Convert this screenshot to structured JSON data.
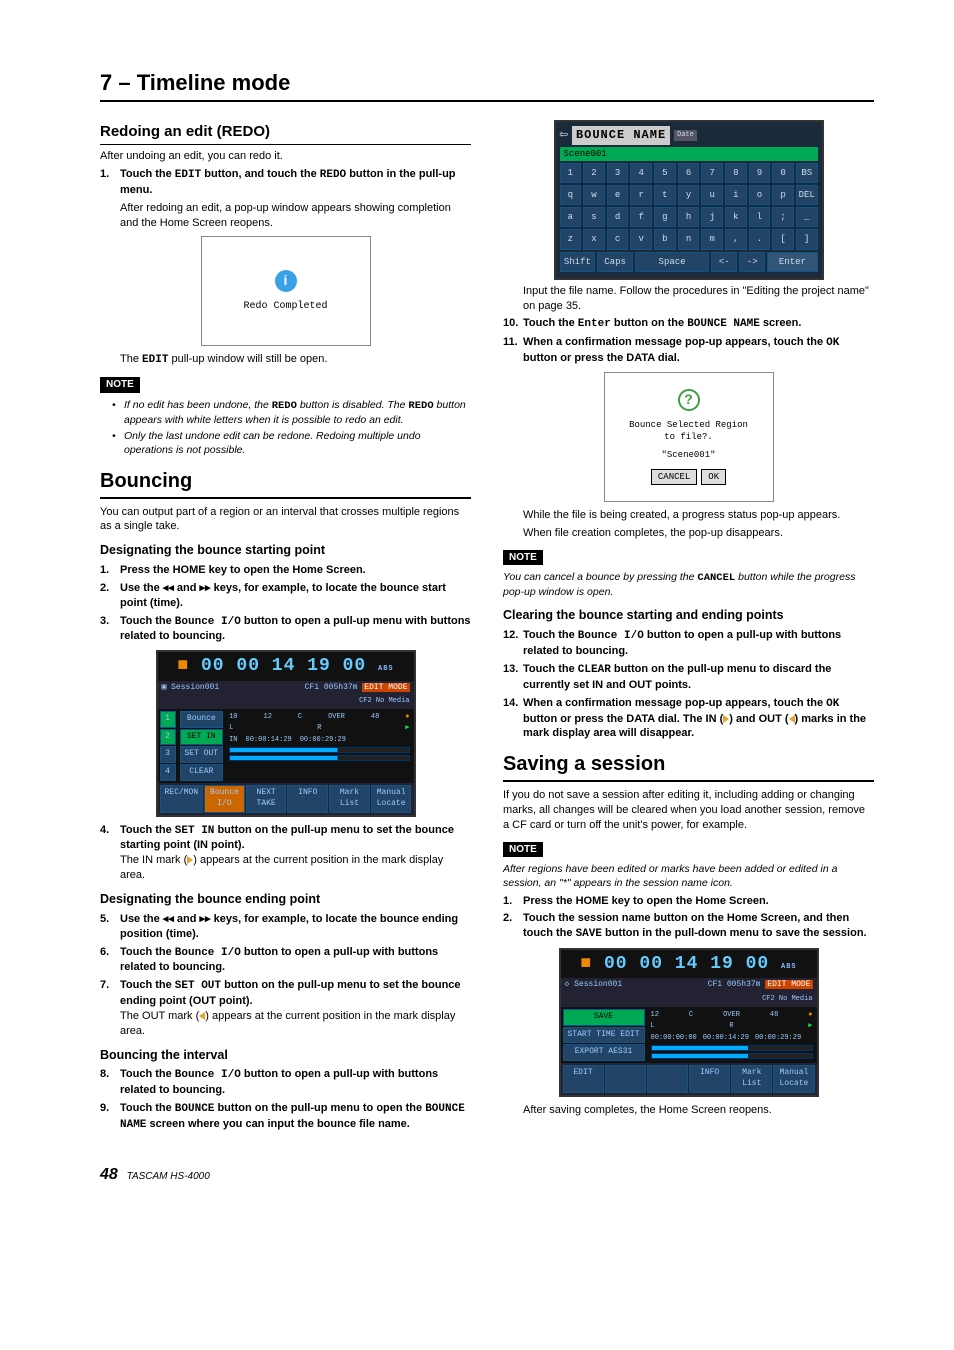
{
  "chapter": "7 – Timeline mode",
  "left": {
    "redo": {
      "heading": "Redoing an edit (REDO)",
      "intro": "After undoing an edit, you can redo it.",
      "step1a": "Touch the ",
      "step1b": " button, and touch the ",
      "step1c": " button in the pull-up menu.",
      "after1": "After redoing an edit, a pop-up window appears showing completion and the Home Screen reopens.",
      "popup": "Redo Completed",
      "after2a": "The ",
      "after2b": " pull-up window will still be open.",
      "note_label": "NOTE",
      "note1a": "If no edit has been undone, the ",
      "note1b": " button is disabled. The ",
      "note1c": " button appears with white letters when it is possible to redo an edit.",
      "note2": "Only the last undone edit can be redone. Redoing multiple undo operations is not possible."
    },
    "bouncing": {
      "heading": "Bouncing",
      "intro": "You can output part of a region or an interval that crosses multiple regions as a single take.",
      "start_h": "Designating the bounce starting point",
      "s1": "Press the HOME key to open the Home Screen.",
      "s2": "Use the  ◂◂  and  ▸▸  keys, for example, to locate the bounce start point (time).",
      "s3a": "Touch the ",
      "s3b": " button to open a pull-up menu with buttons related to bouncing.",
      "screen": {
        "title": "Session001",
        "tc": "00 00  14  19 00",
        "info1": "CF1 005h37m",
        "info2": "CF2 No Media",
        "side": [
          "Bounce",
          "SET IN",
          "SET OUT",
          "CLEAR"
        ],
        "t1": "00:00:14:29",
        "t2": "00:00:29:29",
        "bottom": [
          "REC/MON",
          "Bounce I/O",
          "NEXT TAKE",
          "INFO",
          "Mark List",
          "Manual Locate"
        ]
      },
      "s4a": "Touch the ",
      "s4b": " button on the pull-up menu to set the bounce starting point (IN point).",
      "s4c": "The IN  mark (",
      "s4d": ") appears at the current position in the mark display area.",
      "end_h": "Designating the bounce ending point",
      "s5": "Use the  ◂◂  and  ▸▸  keys, for example, to locate the bounce ending position (time).",
      "s6a": "Touch the ",
      "s6b": " button to open a pull-up with buttons related to bouncing.",
      "s7a": "Touch the ",
      "s7b": " button on the pull-up menu to set the bounce ending point (OUT point).",
      "s7c": "The OUT mark (",
      "s7d": ") appears at the current position in the mark display area.",
      "interval_h": "Bouncing the interval",
      "s8a": "Touch the ",
      "s8b": " button to open a pull-up with buttons related to bouncing.",
      "s9a": "Touch the ",
      "s9b": " button on the pull-up menu to open the ",
      "s9c": " screen where you can input the bounce file name."
    },
    "labels": {
      "EDIT": "EDIT",
      "REDO": "REDO",
      "BounceIO": "Bounce I/O",
      "SETIN": "SET IN",
      "SETOUT": "SET OUT",
      "BOUNCE": "BOUNCE",
      "BOUNCENAME": "BOUNCE NAME"
    }
  },
  "right": {
    "kbd": {
      "title": "BOUNCE NAME",
      "date": "Date",
      "field": "Scene001",
      "row1": [
        "1",
        "2",
        "3",
        "4",
        "5",
        "6",
        "7",
        "8",
        "9",
        "0",
        "BS"
      ],
      "row2": [
        "q",
        "w",
        "e",
        "r",
        "t",
        "y",
        "u",
        "i",
        "o",
        "p",
        "DEL"
      ],
      "row3": [
        "a",
        "s",
        "d",
        "f",
        "g",
        "h",
        "j",
        "k",
        "l",
        ";",
        "_"
      ],
      "row4": [
        "z",
        "x",
        "c",
        "v",
        "b",
        "n",
        "m",
        ",",
        ".",
        "[",
        "]"
      ],
      "row5": [
        "Shift",
        "Caps",
        "Space",
        "<-",
        "->",
        "Enter"
      ]
    },
    "p1": "Input the file name. Follow the procedures in \"Editing the project name\" on page 35.",
    "s10a": "Touch the ",
    "s10b": " button on the ",
    "s10c": " screen.",
    "s11a": "When a confirmation message pop-up appears, touch the ",
    "s11b": " button or press the DATA dial.",
    "confirm": {
      "l1": "Bounce Selected Region",
      "l2": "to file?.",
      "l3": "\"Scene001\"",
      "cancel": "CANCEL",
      "ok": "OK"
    },
    "p2": "While the file is being created, a progress status pop-up appears.",
    "p3": "When file creation completes, the pop-up disappears.",
    "note_label": "NOTE",
    "noteA_a": "You can cancel a bounce by pressing the ",
    "noteA_b": " button while the progress pop-up window is open.",
    "clear_h": "Clearing the bounce starting and ending points",
    "s12a": "Touch the ",
    "s12b": " button to open a pull-up with buttons related to bouncing.",
    "s13a": "Touch the ",
    "s13b": " button on the pull-up menu to discard the currently set IN and OUT points.",
    "s14a": "When a confirmation message pop-up appears, touch the ",
    "s14b": " button or press the DATA dial. The IN (",
    "s14c": ") and OUT (",
    "s14d": ") marks in the mark display area will disappear.",
    "save_h": "Saving a session",
    "save_intro": "If you do not save a session after editing it, including adding or changing marks, all changes will be cleared when you load another session, remove a CF card or turn off the unit's power, for example.",
    "noteB": "After regions have been edited or marks have been added or edited in a session, an \"*\" appears in the session name icon.",
    "sv1": "Press the HOME key to open the Home Screen.",
    "sv2a": "Touch the session name button on the Home Screen, and then touch the ",
    "sv2b": " button in the pull-down menu to save the session.",
    "screen2": {
      "title": "Session001",
      "tc": "00 00  14  19 00",
      "info1": "CF1 005h37m",
      "info2": "CF2 No Media",
      "side": [
        "SAVE",
        "START TIME EDIT",
        "EXPORT AES31"
      ],
      "t0": "00:00:00:00",
      "t1": "00:00:14:29",
      "t2": "00:00:29:29",
      "bottom": [
        "EDIT",
        "",
        "",
        "INFO",
        "Mark List",
        "Manual Locate"
      ]
    },
    "p4": "After saving completes, the Home Screen reopens.",
    "labels": {
      "Enter": "Enter",
      "BOUNCENAME": "BOUNCE NAME",
      "OK": "OK",
      "CANCEL": "CANCEL",
      "BounceIO": "Bounce I/O",
      "CLEAR": "CLEAR",
      "SAVE": "SAVE"
    }
  },
  "footer": {
    "page": "48",
    "product": "TASCAM HS-4000"
  }
}
